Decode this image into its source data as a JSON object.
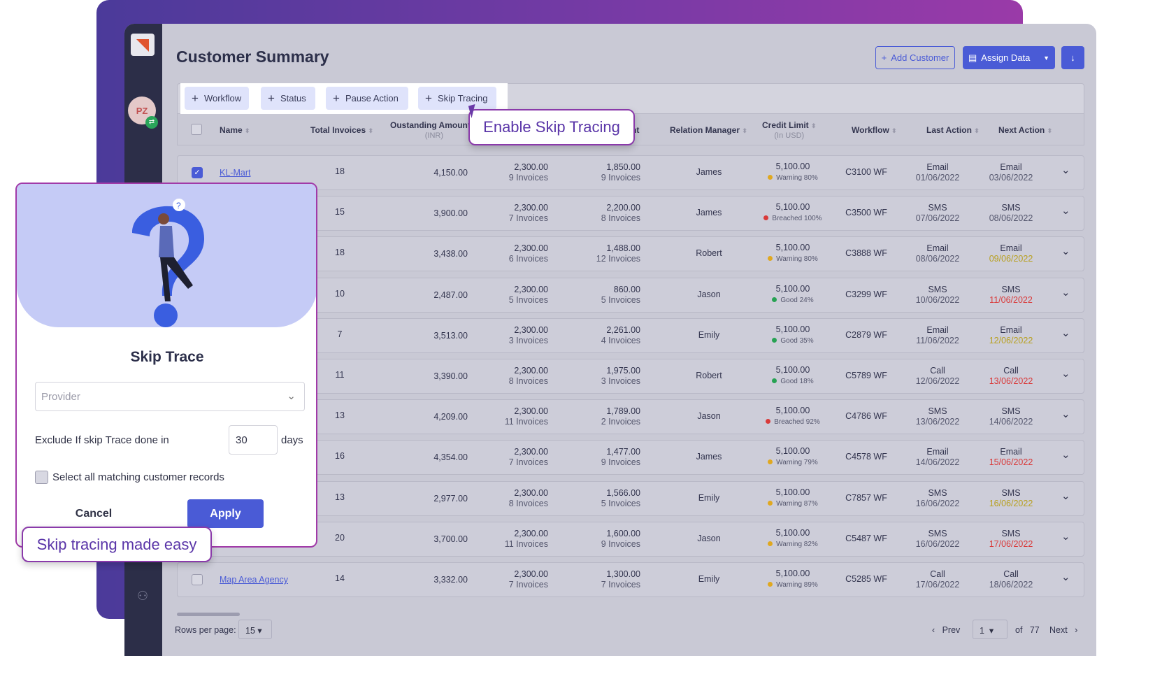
{
  "page_title": "Customer Summary",
  "avatar": "PZ",
  "header_buttons": {
    "add_customer": "Add Customer",
    "assign_data": "Assign Data"
  },
  "toolbar": [
    "Workflow",
    "Status",
    "Pause Action",
    "Skip Tracing"
  ],
  "columns": {
    "name": "Name",
    "total_invoices": "Total Invoices",
    "outstanding": "Oustanding Amount",
    "outstanding_unit": "(INR)",
    "col5_fragment": "nt",
    "relation_manager": "Relation Manager",
    "credit_limit": "Credit Limit",
    "credit_unit": "(In USD)",
    "workflow": "Workflow",
    "last_action": "Last Action",
    "next_action": "Next Action"
  },
  "colors": {
    "good": "#27a253",
    "warning": "#e0a820",
    "breached": "#d93a3a",
    "due_soon": "#b8a020",
    "overdue": "#d93a3a",
    "accent": "#4a5bd6"
  },
  "rows": [
    {
      "name": "KL-Mart",
      "checked": true,
      "total": "18",
      "outstanding": "4,150.00",
      "a1": "2,300.00",
      "a1n": "9 Invoices",
      "a2": "1,850.00",
      "a2n": "9 Invoices",
      "rm": "James",
      "credit": "5,100.00",
      "cstatus": "Warning 80%",
      "clevel": "warning",
      "wf": "C3100 WF",
      "last": "Email",
      "lastd": "01/06/2022",
      "next": "Email",
      "nextd": "03/06/2022",
      "nstate": ""
    },
    {
      "name": "",
      "total": "15",
      "outstanding": "3,900.00",
      "a1": "2,300.00",
      "a1n": "7 Invoices",
      "a2": "2,200.00",
      "a2n": "8 Invoices",
      "rm": "James",
      "credit": "5,100.00",
      "cstatus": "Breached 100%",
      "clevel": "breached",
      "wf": "C3500 WF",
      "last": "SMS",
      "lastd": "07/06/2022",
      "next": "SMS",
      "nextd": "08/06/2022",
      "nstate": ""
    },
    {
      "name": "",
      "total": "18",
      "outstanding": "3,438.00",
      "a1": "2,300.00",
      "a1n": "6 Invoices",
      "a2": "1,488.00",
      "a2n": "12 Invoices",
      "rm": "Robert",
      "credit": "5,100.00",
      "cstatus": "Warning 80%",
      "clevel": "warning",
      "wf": "C3888 WF",
      "last": "Email",
      "lastd": "08/06/2022",
      "next": "Email",
      "nextd": "09/06/2022",
      "nstate": "due_soon"
    },
    {
      "name": "",
      "total": "10",
      "outstanding": "2,487.00",
      "a1": "2,300.00",
      "a1n": "5 Invoices",
      "a2": "860.00",
      "a2n": "5 Invoices",
      "rm": "Jason",
      "credit": "5,100.00",
      "cstatus": "Good 24%",
      "clevel": "good",
      "wf": "C3299 WF",
      "last": "SMS",
      "lastd": "10/06/2022",
      "next": "SMS",
      "nextd": "11/06/2022",
      "nstate": "overdue"
    },
    {
      "name": "",
      "total": "7",
      "outstanding": "3,513.00",
      "a1": "2,300.00",
      "a1n": "3 Invoices",
      "a2": "2,261.00",
      "a2n": "4 Invoices",
      "rm": "Emily",
      "credit": "5,100.00",
      "cstatus": "Good 35%",
      "clevel": "good",
      "wf": "C2879 WF",
      "last": "Email",
      "lastd": "11/06/2022",
      "next": "Email",
      "nextd": "12/06/2022",
      "nstate": "due_soon"
    },
    {
      "name": "",
      "total": "11",
      "outstanding": "3,390.00",
      "a1": "2,300.00",
      "a1n": "8 Invoices",
      "a2": "1,975.00",
      "a2n": "3 Invoices",
      "rm": "Robert",
      "credit": "5,100.00",
      "cstatus": "Good 18%",
      "clevel": "good",
      "wf": "C5789 WF",
      "last": "Call",
      "lastd": "12/06/2022",
      "next": "Call",
      "nextd": "13/06/2022",
      "nstate": "overdue"
    },
    {
      "name": "",
      "total": "13",
      "outstanding": "4,209.00",
      "a1": "2,300.00",
      "a1n": "11 Invoices",
      "a2": "1,789.00",
      "a2n": "2 Invoices",
      "rm": "Jason",
      "credit": "5,100.00",
      "cstatus": "Breached 92%",
      "clevel": "breached",
      "wf": "C4786 WF",
      "last": "SMS",
      "lastd": "13/06/2022",
      "next": "SMS",
      "nextd": "14/06/2022",
      "nstate": ""
    },
    {
      "name": "",
      "total": "16",
      "outstanding": "4,354.00",
      "a1": "2,300.00",
      "a1n": "7 Invoices",
      "a2": "1,477.00",
      "a2n": "9 Invoices",
      "rm": "James",
      "credit": "5,100.00",
      "cstatus": "Warning 79%",
      "clevel": "warning",
      "wf": "C4578 WF",
      "last": "Email",
      "lastd": "14/06/2022",
      "next": "Email",
      "nextd": "15/06/2022",
      "nstate": "overdue"
    },
    {
      "name": "",
      "total": "13",
      "outstanding": "2,977.00",
      "a1": "2,300.00",
      "a1n": "8 Invoices",
      "a2": "1,566.00",
      "a2n": "5 Invoices",
      "rm": "Emily",
      "credit": "5,100.00",
      "cstatus": "Warning 87%",
      "clevel": "warning",
      "wf": "C7857 WF",
      "last": "SMS",
      "lastd": "16/06/2022",
      "next": "SMS",
      "nextd": "16/06/2022",
      "nstate": "due_soon"
    },
    {
      "name": "",
      "total": "20",
      "outstanding": "3,700.00",
      "a1": "2,300.00",
      "a1n": "11 Invoices",
      "a2": "1,600.00",
      "a2n": "9 Invoices",
      "rm": "Jason",
      "credit": "5,100.00",
      "cstatus": "Warning 82%",
      "clevel": "warning",
      "wf": "C5487 WF",
      "last": "SMS",
      "lastd": "16/06/2022",
      "next": "SMS",
      "nextd": "17/06/2022",
      "nstate": "overdue"
    },
    {
      "name": "Map Area Agency",
      "total": "14",
      "outstanding": "3,332.00",
      "a1": "2,300.00",
      "a1n": "7 Invoices",
      "a2": "1,300.00",
      "a2n": "7 Invoices",
      "rm": "Emily",
      "credit": "5,100.00",
      "cstatus": "Warning 89%",
      "clevel": "warning",
      "wf": "C5285 WF",
      "last": "Call",
      "lastd": "17/06/2022",
      "next": "Call",
      "nextd": "18/06/2022",
      "nstate": ""
    }
  ],
  "pagination": {
    "rows_label": "Rows per page:",
    "rows_value": "15",
    "prev": "Prev",
    "page": "1",
    "of": "of",
    "total": "77",
    "next": "Next"
  },
  "modal": {
    "title": "Skip Trace",
    "provider_placeholder": "Provider",
    "exclude_label": "Exclude If skip Trace done in",
    "days_value": "30",
    "days_unit": "days",
    "select_all": "Select all matching customer records",
    "cancel": "Cancel",
    "apply": "Apply"
  },
  "callouts": {
    "enable": "Enable Skip Tracing",
    "easy": "Skip tracing made easy"
  }
}
